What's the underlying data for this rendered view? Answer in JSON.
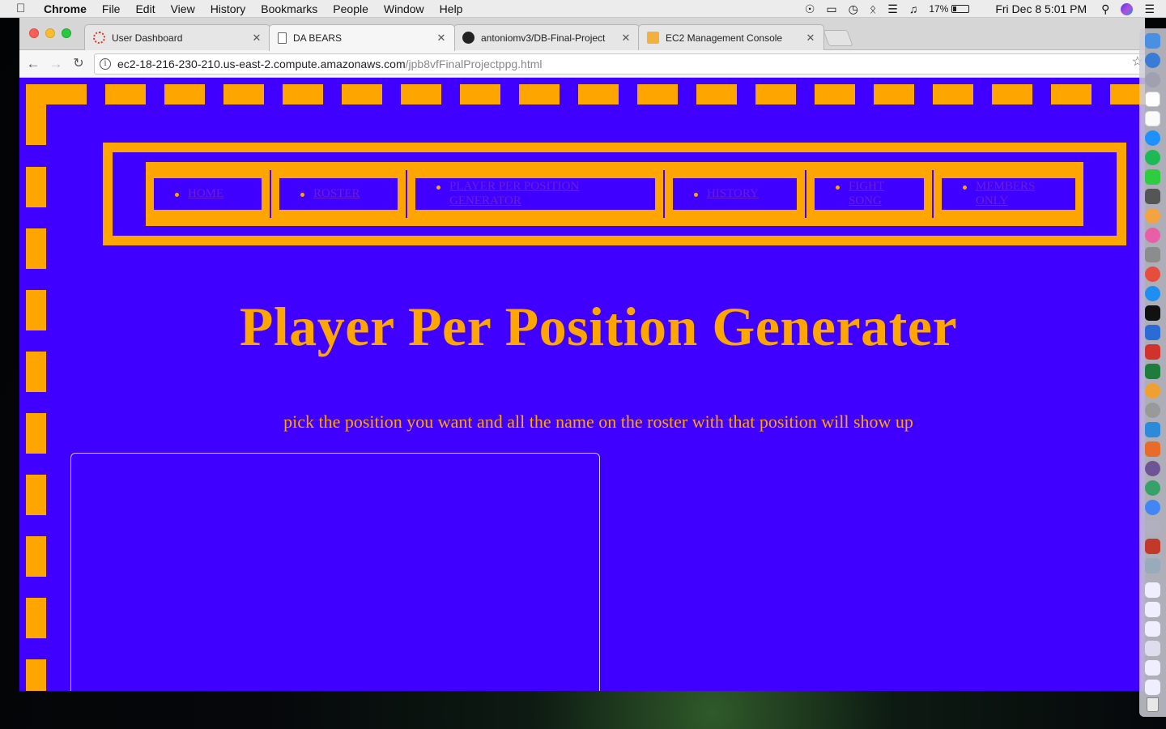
{
  "menubar": {
    "app_name": "Chrome",
    "menus": [
      "File",
      "Edit",
      "View",
      "History",
      "Bookmarks",
      "People",
      "Window",
      "Help"
    ],
    "battery": "17%",
    "clock": "Fri Dec 8  5:01 PM"
  },
  "tabs": [
    {
      "label": "User Dashboard",
      "icon": "red-ring-icon"
    },
    {
      "label": "DA BEARS",
      "icon": "page-icon"
    },
    {
      "label": "antoniomv3/DB-Final-Project",
      "icon": "github-icon"
    },
    {
      "label": "EC2 Management Console",
      "icon": "aws-cube-icon"
    }
  ],
  "address_bar": {
    "host": "ec2-18-216-230-210.us-east-2.compute.amazonaws.com",
    "path": "/jpb8vfFinalProjectppg.html"
  },
  "nav": {
    "items": [
      {
        "label": "HOME"
      },
      {
        "label": "ROSTER"
      },
      {
        "label": "PLAYER PER POSITION GENERATOR"
      },
      {
        "label": "HISTORY"
      },
      {
        "label": "FIGHT SONG"
      },
      {
        "label": "MEMBERS ONLY"
      }
    ]
  },
  "page": {
    "heading": "Player Per Position Generater",
    "subtext": "pick the position you want and all the name on the roster with that position will show up"
  },
  "colors": {
    "page_background": "#4000ff",
    "accent": "#ffa500",
    "link": "#6a1fd6"
  }
}
